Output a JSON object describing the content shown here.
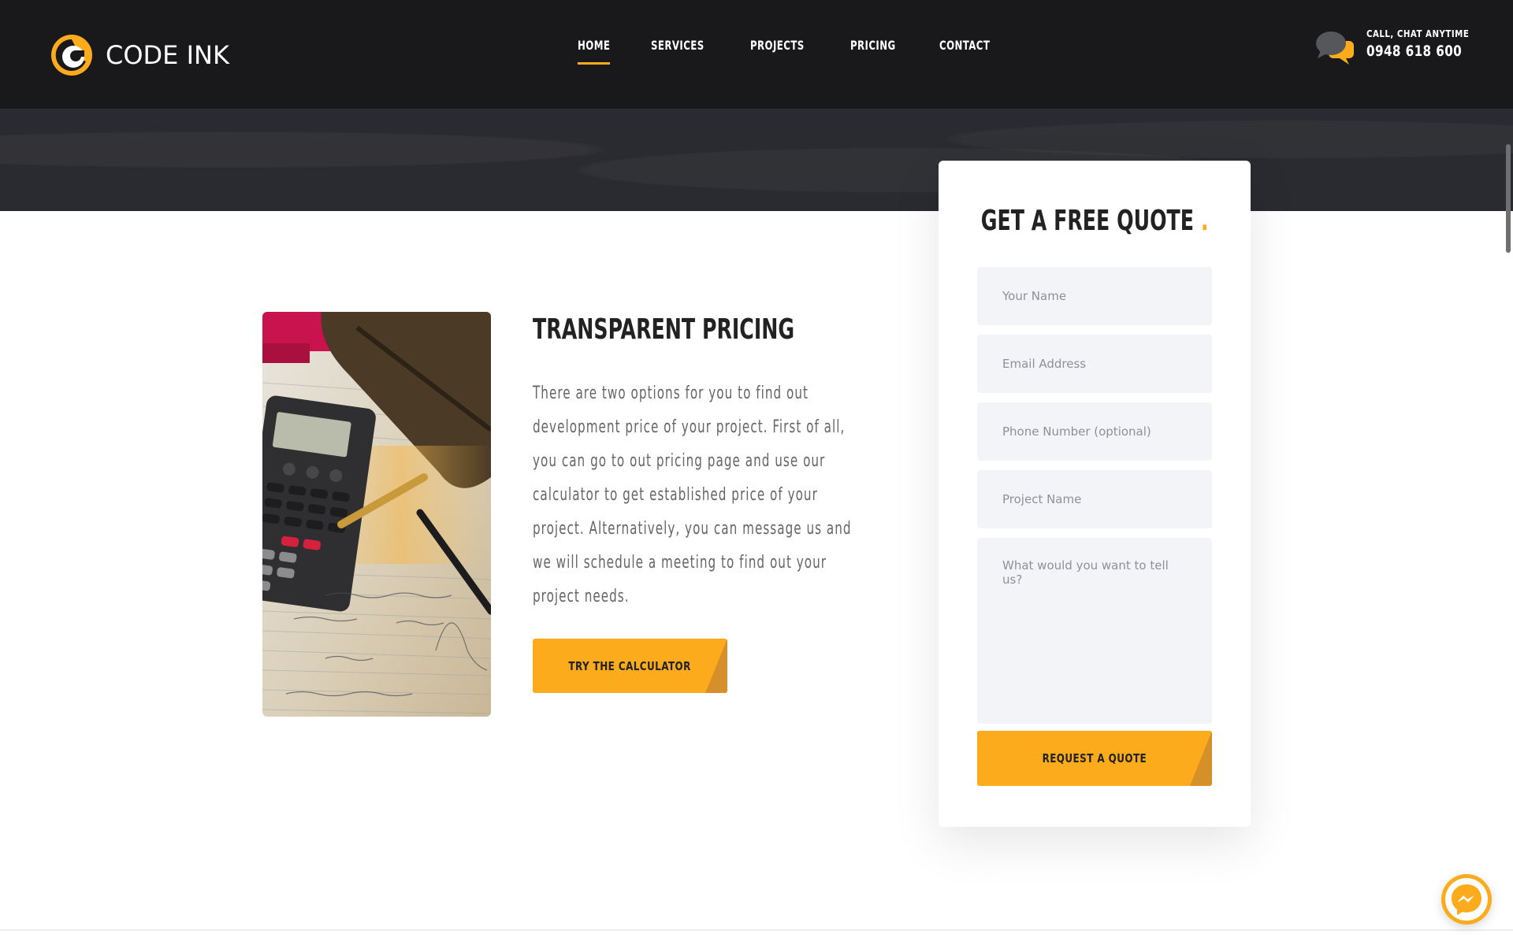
{
  "brand": {
    "name": "CODE INK"
  },
  "nav": {
    "items": [
      {
        "label": "HOME",
        "active": true
      },
      {
        "label": "SERVICES",
        "active": false
      },
      {
        "label": "PROJECTS",
        "active": false
      },
      {
        "label": "PRICING",
        "active": false
      },
      {
        "label": "CONTACT",
        "active": false
      }
    ]
  },
  "contact": {
    "caption": "CALL, CHAT ANYTIME",
    "phone": "0948 618 600"
  },
  "pricing": {
    "title": "TRANSPARENT PRICING",
    "body": "There are two options for you to find out development price of your project. First of all, you can go to out pricing page and use our calculator to get established price of your project. Alternatively, you can message us and we will schedule a meeting to find out your project needs.",
    "button": "TRY THE CALCULATOR"
  },
  "quote_form": {
    "title": "GET A FREE QUOTE",
    "title_dot": ".",
    "name_placeholder": "Your Name",
    "email_placeholder": "Email Address",
    "phone_placeholder": "Phone Number (optional)",
    "project_placeholder": "Project Name",
    "message_placeholder": "What would you want to tell us?",
    "submit": "REQUEST A QUOTE"
  },
  "colors": {
    "accent": "#fbab1b",
    "header_bg": "#19191b",
    "hero_bg": "#2a2b30"
  },
  "icons": [
    "chat-bubbles-icon",
    "messenger-icon"
  ]
}
